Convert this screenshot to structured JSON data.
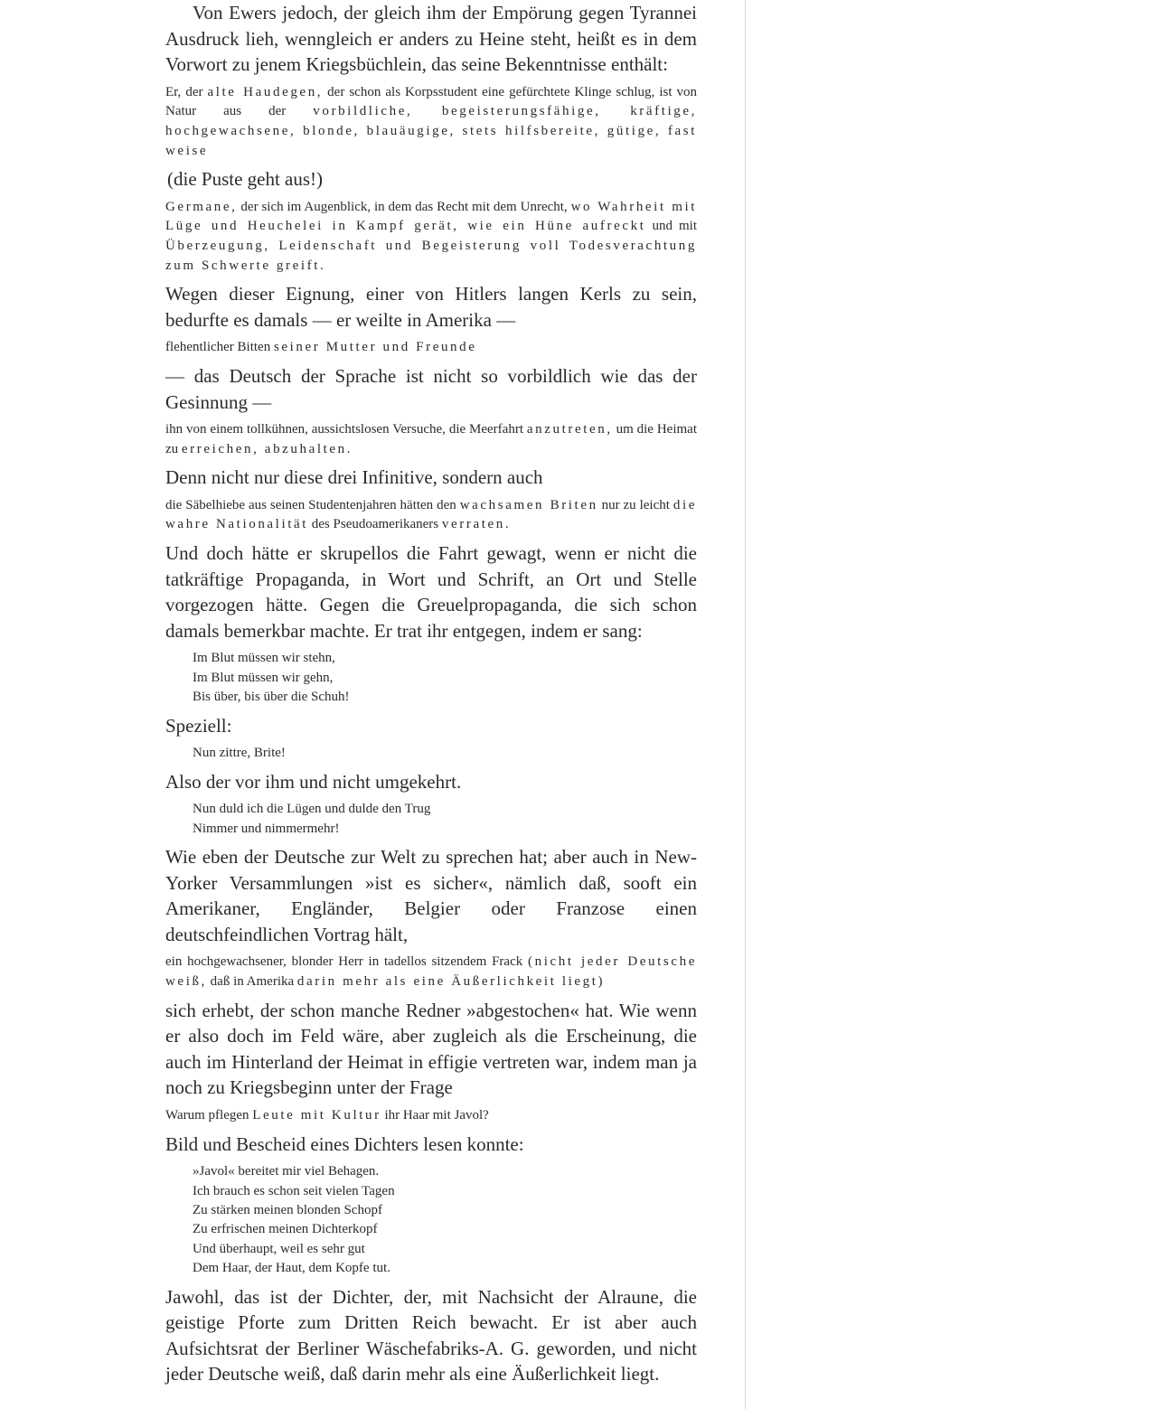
{
  "document": {
    "blocks": [
      {
        "type": "big",
        "first": true,
        "segments": [
          {
            "t": "Von Ewers jedoch, der gleich ihm der Empörung gegen Tyrannei Ausdruck lieh, wenngleich er anders zu Heine steht, heißt es in dem Vorwort zu jenem Kriegsbüchlein, das seine Bekenntnisse enthält:"
          }
        ]
      },
      {
        "type": "small",
        "segments": [
          {
            "t": "Er, der "
          },
          {
            "t": "alte Haudegen,",
            "s": true
          },
          {
            "t": " der schon als Korpsstudent eine gefürchtete Klinge schlug, ist von Natur aus der "
          },
          {
            "t": "vorbildliche, begeisterungsfähige, kräftige, hochgewachsene, blonde, blauäugige, stets hilfsbereite, gütige, fast weise",
            "s": true
          }
        ]
      },
      {
        "type": "big",
        "aside": true,
        "segments": [
          {
            "t": "(die Puste geht aus!)"
          }
        ]
      },
      {
        "type": "small",
        "segments": [
          {
            "t": "Germane,",
            "s": true
          },
          {
            "t": " der sich im Augenblick, in dem das Recht mit dem Unrecht, "
          },
          {
            "t": "wo Wahrheit mit Lüge und Heuchelei in Kampf gerät, wie ein Hüne aufreckt",
            "s": true
          },
          {
            "t": " und mit "
          },
          {
            "t": "Überzeugung, Leidenschaft und Begeisterung voll Todesverachtung zum Schwerte greift.",
            "s": true
          }
        ]
      },
      {
        "type": "big",
        "segments": [
          {
            "t": "Wegen dieser Eignung, einer von Hitlers langen Kerls zu sein, bedurfte es damals — er weilte in Amerika —"
          }
        ]
      },
      {
        "type": "small",
        "segments": [
          {
            "t": "flehentlicher Bitten "
          },
          {
            "t": "seiner Mutter und Freunde",
            "s": true
          }
        ]
      },
      {
        "type": "big",
        "segments": [
          {
            "t": "— das Deutsch der Sprache ist nicht so vorbildlich wie das der Gesinnung —"
          }
        ]
      },
      {
        "type": "small",
        "segments": [
          {
            "t": "ihn von einem tollkühnen, aussichtslosen Versuche, die Meerfahrt "
          },
          {
            "t": "anzutreten,",
            "s": true
          },
          {
            "t": " um die Heimat zu "
          },
          {
            "t": "erreichen, abzuhalten.",
            "s": true
          }
        ]
      },
      {
        "type": "big",
        "segments": [
          {
            "t": "Denn nicht nur diese drei Infinitive, sondern auch"
          }
        ]
      },
      {
        "type": "small",
        "segments": [
          {
            "t": "die Säbelhiebe aus seinen Studentenjahren hätten den "
          },
          {
            "t": "wachsamen Briten",
            "s": true
          },
          {
            "t": " nur zu leicht "
          },
          {
            "t": "die wahre Nationalität",
            "s": true
          },
          {
            "t": " des Pseudoamerikaners "
          },
          {
            "t": "verraten.",
            "s": true
          }
        ]
      },
      {
        "type": "big",
        "segments": [
          {
            "t": "Und doch hätte er skrupellos die Fahrt gewagt, wenn er nicht die tatkräftige Propaganda, in Wort und Schrift, an Ort und Stelle vorgezogen hätte. Gegen die Greuelpropaganda, die sich schon damals bemerkbar machte. Er trat ihr entgegen, indem er sang:"
          }
        ]
      },
      {
        "type": "verse",
        "lines": [
          "Im Blut müssen wir stehn,",
          "Im Blut müssen wir gehn,",
          "Bis über, bis über die Schuh!"
        ]
      },
      {
        "type": "big",
        "segments": [
          {
            "t": "Speziell:"
          }
        ]
      },
      {
        "type": "verse",
        "lines": [
          "Nun zittre, Brite!"
        ]
      },
      {
        "type": "big",
        "segments": [
          {
            "t": "Also der vor ihm und nicht umgekehrt."
          }
        ]
      },
      {
        "type": "verse",
        "lines": [
          "Nun duld ich die Lügen und dulde den Trug",
          "Nimmer und nimmermehr!"
        ]
      },
      {
        "type": "big",
        "segments": [
          {
            "t": "Wie eben der Deutsche zur Welt zu sprechen hat; aber auch in New-Yorker Versammlungen »ist es sicher«, nämlich daß, sooft ein Amerikaner, Engländer, Belgier oder Franzose einen deutschfeindlichen Vortrag hält,"
          }
        ]
      },
      {
        "type": "small",
        "segments": [
          {
            "t": "ein hochgewachsener, blonder Herr in tadellos sitzendem Frack "
          },
          {
            "t": "(nicht jeder Deutsche weiß,",
            "s": true
          },
          {
            "t": " daß in Amerika "
          },
          {
            "t": "darin mehr als eine Äußerlichkeit liegt)",
            "s": true
          }
        ]
      },
      {
        "type": "big",
        "segments": [
          {
            "t": "sich erhebt, der schon manche Redner »abgestochen« hat. Wie wenn er also doch im Feld wäre, aber zugleich als die Erscheinung, die auch im Hinterland der Heimat in effigie vertreten war, indem man ja noch zu Kriegsbeginn unter der Frage"
          }
        ]
      },
      {
        "type": "small",
        "segments": [
          {
            "t": "Warum pflegen "
          },
          {
            "t": "Leute mit Kultur",
            "s": true
          },
          {
            "t": " ihr Haar mit Javol?"
          }
        ]
      },
      {
        "type": "big",
        "segments": [
          {
            "t": "Bild und Bescheid eines Dichters lesen konnte:"
          }
        ]
      },
      {
        "type": "verse",
        "lines": [
          "»Javol« bereitet mir viel Behagen.",
          "Ich brauch es schon seit vielen Tagen",
          "Zu stärken meinen blonden Schopf",
          "Zu erfrischen meinen Dichterkopf",
          "Und überhaupt, weil es sehr gut",
          "Dem Haar, der Haut, dem Kopfe tut."
        ]
      },
      {
        "type": "big",
        "segments": [
          {
            "t": "Jawohl, das ist der Dichter, der, mit Nachsicht der Alraune, die geistige Pforte zum Dritten Reich bewacht. Er ist aber auch Aufsichtsrat der Berliner Wäschefabriks-A. G. geworden, und nicht jeder Deutsche weiß, daß darin mehr als eine Äußerlichkeit liegt."
          }
        ]
      }
    ]
  }
}
